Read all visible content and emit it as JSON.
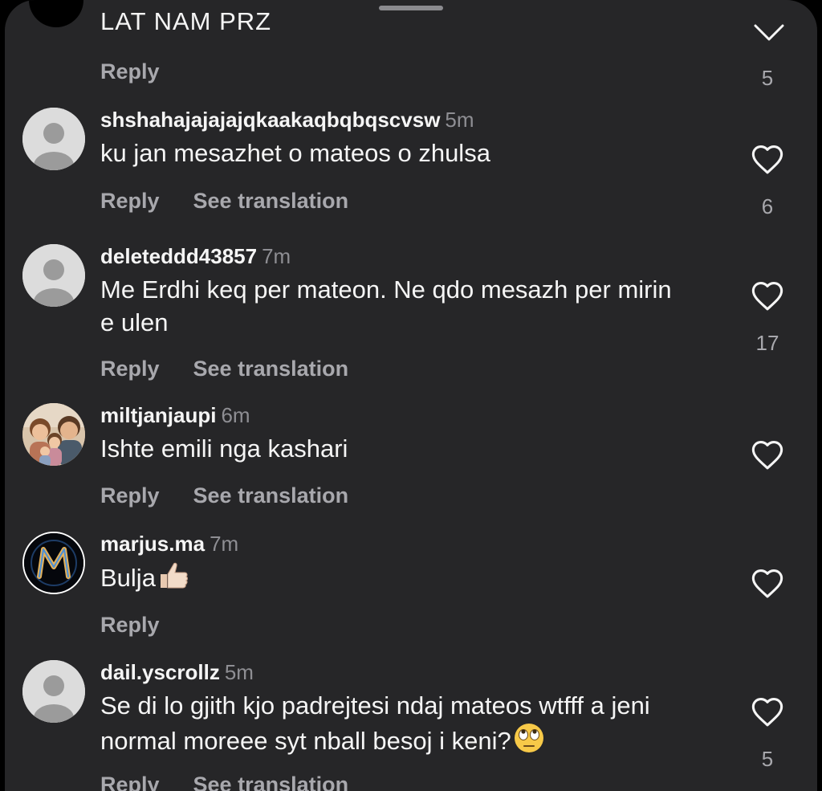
{
  "top_comment": {
    "text": "LAT NAM PRZ",
    "reply_label": "Reply",
    "like_count": "5"
  },
  "comments": [
    {
      "username": "shshahajajajajqkaakaqbqbqscvsw",
      "time": "5m",
      "text": "ku jan mesazhet o mateos o zhulsa",
      "reply_label": "Reply",
      "translate_label": "See translation",
      "like_count": "6",
      "avatar": "default-avatar"
    },
    {
      "username": "deleteddd43857",
      "time": "7m",
      "text": "Me Erdhi keq per mateon. Ne qdo mesazh per mirin e ulen",
      "reply_label": "Reply",
      "translate_label": "See translation",
      "like_count": "17",
      "avatar": "default-avatar"
    },
    {
      "username": "miltjanjaupi",
      "time": "6m",
      "text": "Ishte emili nga kashari",
      "reply_label": "Reply",
      "translate_label": "See translation",
      "like_count": "",
      "avatar": "family-photo"
    },
    {
      "username": "marjus.ma",
      "time": "7m",
      "text": "Bulja",
      "emoji": "thumbs-up",
      "reply_label": "Reply",
      "like_count": "",
      "avatar": "m-logo"
    },
    {
      "username": "dail.yscrollz",
      "time": "5m",
      "text": "Se di lo gjith kjo padrejtesi ndaj mateos wtfff a jeni normal moreee syt nball besoj i keni?",
      "emoji": "eye-roll",
      "reply_label": "Reply",
      "translate_label": "See translation",
      "like_count": "5",
      "avatar": "default-avatar"
    }
  ],
  "icons": {
    "like": "heart-outline-icon",
    "collapse": "chevron-down-icon"
  },
  "colors": {
    "background": "#262628",
    "text": "#f5f5f5",
    "secondary": "#a8a8ad",
    "timestamp": "#8e8e93"
  }
}
